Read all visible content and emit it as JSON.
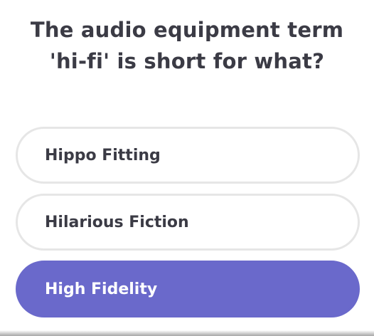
{
  "question": {
    "text": "The audio equipment term 'hi-fi' is short for what?"
  },
  "answers": [
    {
      "label": "Hippo Fitting",
      "selected": false
    },
    {
      "label": "Hilarious Fiction",
      "selected": false
    },
    {
      "label": "High Fidelity",
      "selected": true
    }
  ],
  "colors": {
    "accent": "#6a69cb",
    "text": "#3b3b45",
    "border": "#e6e6e6"
  }
}
